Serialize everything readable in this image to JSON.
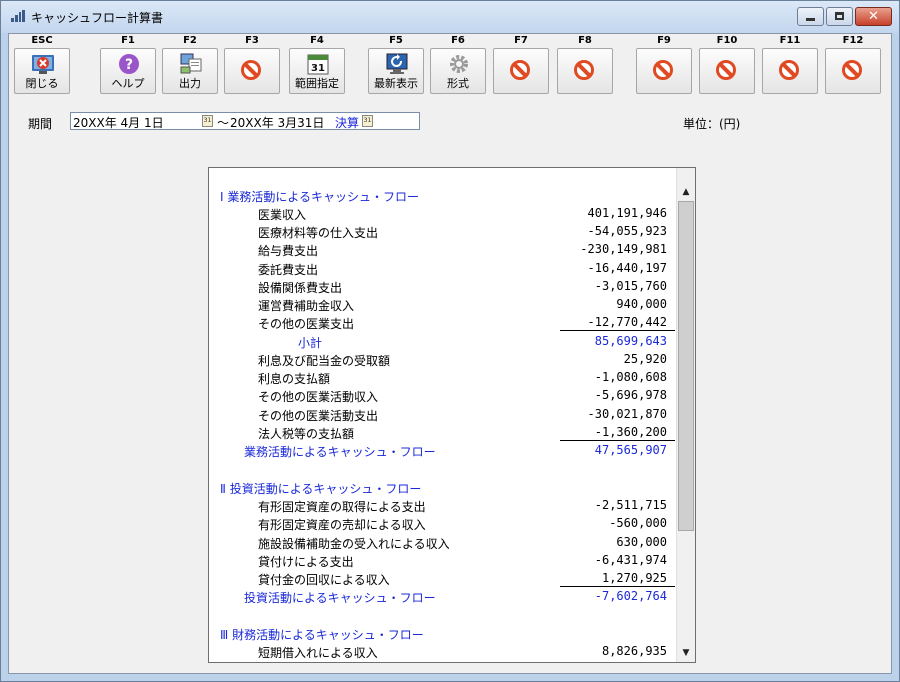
{
  "window": {
    "title": "キャッシュフロー計算書"
  },
  "toolbar": {
    "buttons": [
      {
        "key": "ESC",
        "label": "閉じる"
      },
      {
        "key": "F1",
        "label": "ヘルプ"
      },
      {
        "key": "F2",
        "label": "出力"
      },
      {
        "key": "F3",
        "label": ""
      },
      {
        "key": "F4",
        "label": "範囲指定"
      },
      {
        "key": "F5",
        "label": "最新表示"
      },
      {
        "key": "F6",
        "label": "形式"
      },
      {
        "key": "F7",
        "label": ""
      },
      {
        "key": "F8",
        "label": ""
      },
      {
        "key": "F9",
        "label": ""
      },
      {
        "key": "F10",
        "label": ""
      },
      {
        "key": "F11",
        "label": ""
      },
      {
        "key": "F12",
        "label": ""
      }
    ],
    "icons": [
      "close-icon",
      "help-icon",
      "output-icon",
      "disabled-icon",
      "calendar-icon",
      "refresh-icon",
      "gear-icon",
      "disabled-icon",
      "disabled-icon",
      "disabled-icon",
      "disabled-icon",
      "disabled-icon",
      "disabled-icon"
    ],
    "calendar_day": "31"
  },
  "period": {
    "label": "期間",
    "start": "20XX年 4月 1日",
    "separator": "～",
    "end": "20XX年 3月31日",
    "closing": "決算",
    "unit": "単位：(円)"
  },
  "report": {
    "section1": {
      "title": "Ⅰ 業務活動によるキャッシュ・フロー",
      "items": [
        {
          "label": "医業収入",
          "value": "401,191,946"
        },
        {
          "label": "医療材料等の仕入支出",
          "value": "-54,055,923"
        },
        {
          "label": "給与費支出",
          "value": "-230,149,981"
        },
        {
          "label": "委託費支出",
          "value": "-16,440,197"
        },
        {
          "label": "設備関係費支出",
          "value": "-3,015,760"
        },
        {
          "label": "運営費補助金収入",
          "value": "940,000"
        },
        {
          "label": "その他の医業支出",
          "value": "-12,770,442"
        }
      ],
      "subtotal_label": "小計",
      "subtotal_value": "85,699,643",
      "items2": [
        {
          "label": "利息及び配当金の受取額",
          "value": "25,920"
        },
        {
          "label": "利息の支払額",
          "value": "-1,080,608"
        },
        {
          "label": "その他の医業活動収入",
          "value": "-5,696,978"
        },
        {
          "label": "その他の医業活動支出",
          "value": "-30,021,870"
        },
        {
          "label": "法人税等の支払額",
          "value": "-1,360,200"
        }
      ],
      "total_label": "業務活動によるキャッシュ・フロー",
      "total_value": "47,565,907"
    },
    "section2": {
      "title": "Ⅱ 投資活動によるキャッシュ・フロー",
      "items": [
        {
          "label": "有形固定資産の取得による支出",
          "value": "-2,511,715"
        },
        {
          "label": "有形固定資産の売却による収入",
          "value": "-560,000"
        },
        {
          "label": "施設設備補助金の受入れによる収入",
          "value": "630,000"
        },
        {
          "label": "貸付けによる支出",
          "value": "-6,431,974"
        },
        {
          "label": "貸付金の回収による収入",
          "value": "1,270,925"
        }
      ],
      "total_label": "投資活動によるキャッシュ・フロー",
      "total_value": "-7,602,764"
    },
    "section3": {
      "title": "Ⅲ 財務活動によるキャッシュ・フロー",
      "items": [
        {
          "label": "短期借入れによる収入",
          "value": "8,826,935"
        }
      ]
    }
  }
}
